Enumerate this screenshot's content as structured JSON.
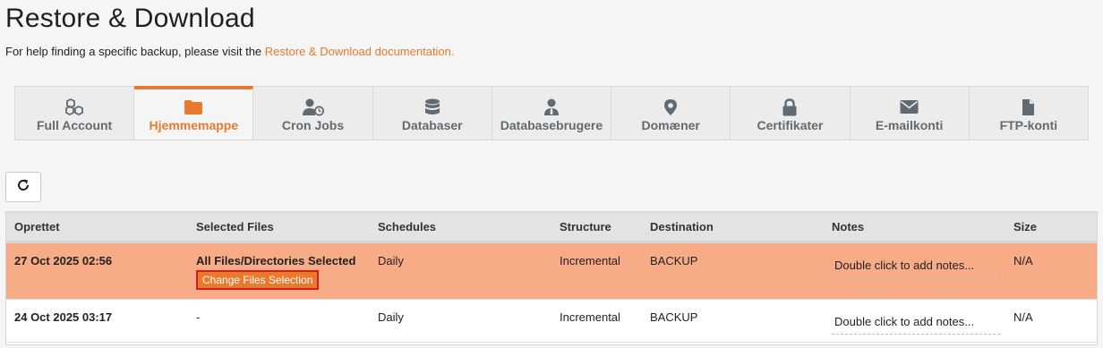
{
  "page": {
    "title": "Restore & Download",
    "help_prefix": "For help finding a specific backup, please visit the ",
    "help_link": "Restore & Download documentation."
  },
  "colors": {
    "accent": "#e8792d",
    "selected_row": "#f8ab87",
    "highlight_border": "#d0201b"
  },
  "tabs": [
    {
      "label": "Full Account",
      "icon": "cubes-icon",
      "active": false
    },
    {
      "label": "Hjemmemappe",
      "icon": "folder-icon",
      "active": true
    },
    {
      "label": "Cron Jobs",
      "icon": "user-clock-icon",
      "active": false
    },
    {
      "label": "Databaser",
      "icon": "database-icon",
      "active": false
    },
    {
      "label": "Databasebrugere",
      "icon": "user-tie-icon",
      "active": false
    },
    {
      "label": "Domæner",
      "icon": "map-marker-icon",
      "active": false
    },
    {
      "label": "Certifikater",
      "icon": "lock-icon",
      "active": false
    },
    {
      "label": "E-mailkonti",
      "icon": "envelope-icon",
      "active": false
    },
    {
      "label": "FTP-konti",
      "icon": "file-icon",
      "active": false
    }
  ],
  "refresh": {
    "icon": "refresh-icon"
  },
  "table": {
    "headers": [
      "Oprettet",
      "Selected Files",
      "Schedules",
      "Structure",
      "Destination",
      "Notes",
      "Size"
    ],
    "rows": [
      {
        "created": "27 Oct 2025 02:56",
        "files": "All Files/Directories Selected",
        "change_button": "Change Files Selection",
        "schedule": "Daily",
        "structure": "Incremental",
        "destination": "BACKUP",
        "notes": "Double click to add notes...",
        "size": "N/A"
      },
      {
        "created": "24 Oct 2025 03:17",
        "files": "-",
        "schedule": "Daily",
        "structure": "Incremental",
        "destination": "BACKUP",
        "notes": "Double click to add notes...",
        "size": "N/A"
      }
    ]
  }
}
